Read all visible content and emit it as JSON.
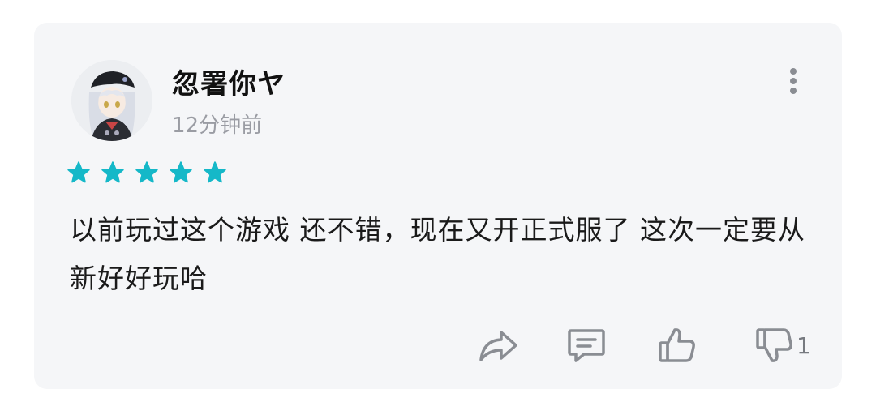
{
  "review": {
    "username": "⁢忽署你ヤ",
    "time": "12分钟前",
    "rating": 5,
    "rating_max": 5,
    "text": "以前玩过这个游戏 还不错，现在又开正式服了 这次一定要从新好好玩哈"
  },
  "actions": {
    "share_icon": "share-arrow-icon",
    "comment_icon": "comment-icon",
    "like_icon": "thumbs-up-icon",
    "dislike_icon": "thumbs-down-icon",
    "dislike_count": "1"
  },
  "colors": {
    "card_bg": "#f5f6f8",
    "star": "#15b8c8",
    "icon": "#8a8d93",
    "text": "#1a1a1a",
    "muted": "#9a9ca3"
  }
}
